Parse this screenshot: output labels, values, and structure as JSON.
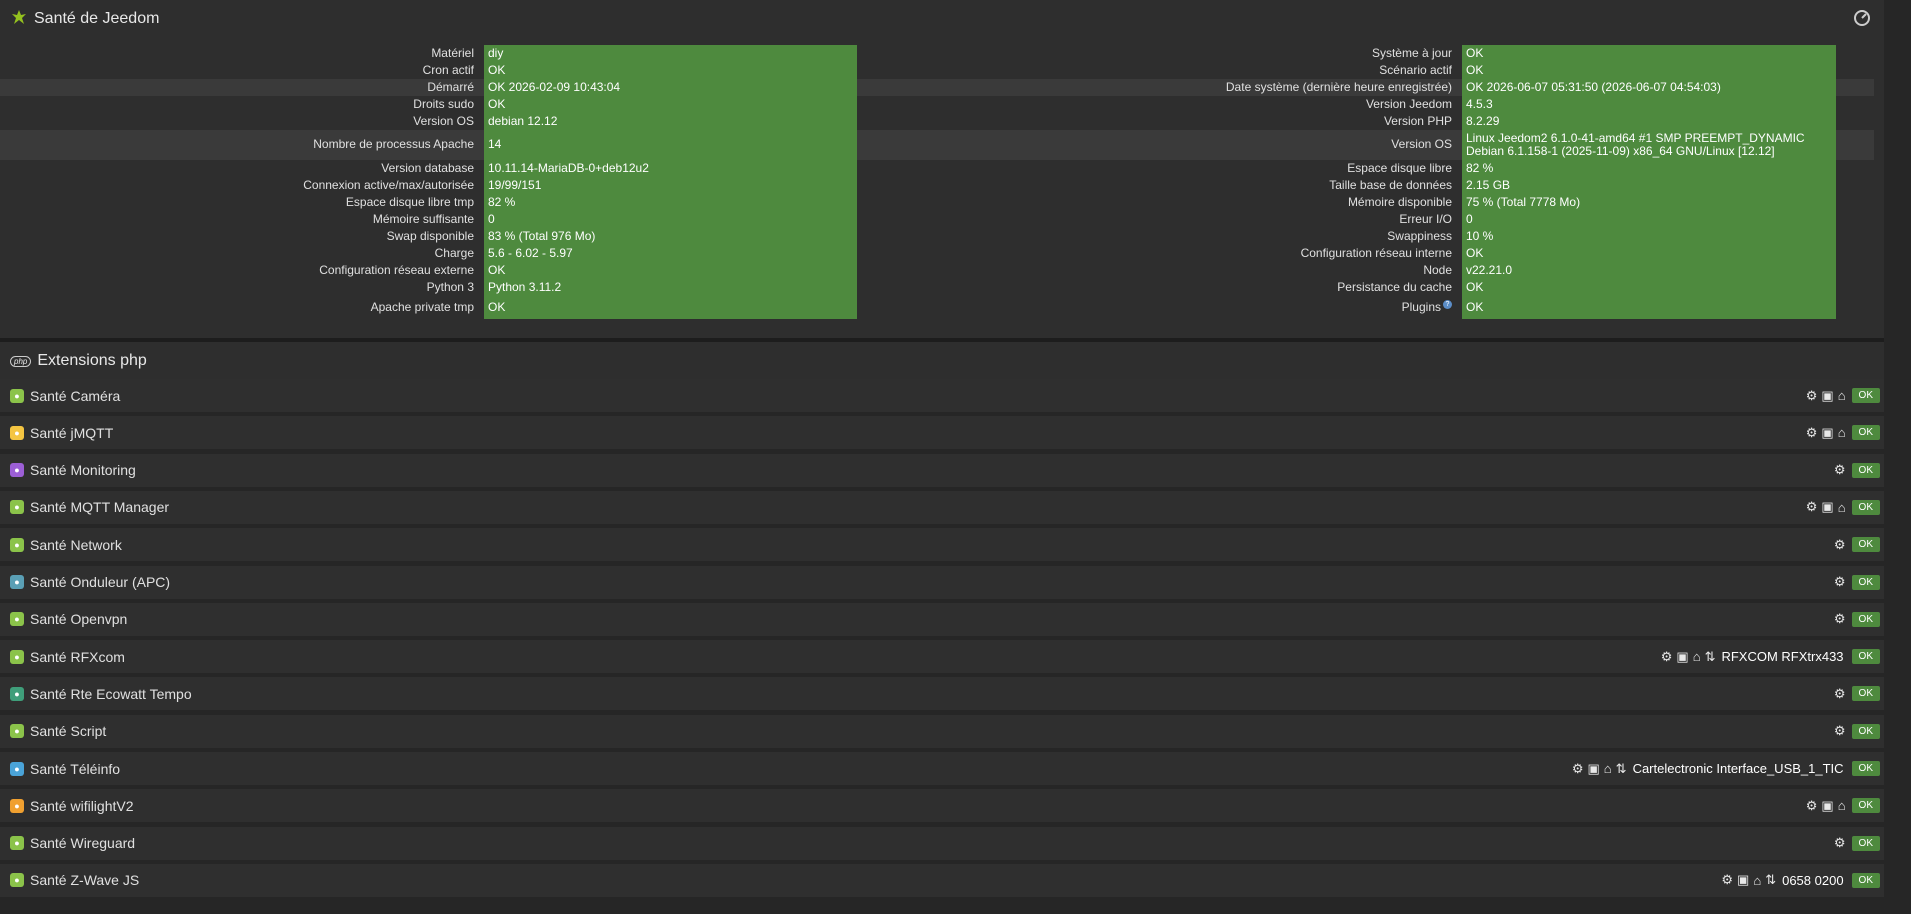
{
  "health": {
    "title": "Santé de Jeedom",
    "left": [
      {
        "label": "Matériel",
        "value": "diy"
      },
      {
        "label": "Cron actif",
        "value": "OK"
      },
      {
        "label": "Démarré",
        "value": "OK 2026-02-09 10:43:04"
      },
      {
        "label": "Droits sudo",
        "value": "OK"
      },
      {
        "label": "Version OS",
        "value": "debian 12.12"
      },
      {
        "label": "Nombre de processus Apache",
        "value": "14"
      },
      {
        "label": "Version database",
        "value": "10.11.14-MariaDB-0+deb12u2"
      },
      {
        "label": "Connexion active/max/autorisée",
        "value": "19/99/151"
      },
      {
        "label": "Espace disque libre tmp",
        "value": "82 %"
      },
      {
        "label": "Mémoire suffisante",
        "value": "0"
      },
      {
        "label": "Swap disponible",
        "value": "83 % (Total 976 Mo)"
      },
      {
        "label": "Charge",
        "value": "5.6 - 6.02 - 5.97"
      },
      {
        "label": "Configuration réseau externe",
        "value": "OK"
      },
      {
        "label": "Python 3",
        "value": "Python 3.11.2"
      },
      {
        "label": "Apache private tmp",
        "value": "OK"
      }
    ],
    "right": [
      {
        "label": "Système à jour",
        "value": "OK"
      },
      {
        "label": "Scénario actif",
        "value": "OK"
      },
      {
        "label": "Date système (dernière heure enregistrée)",
        "value": "OK 2026-06-07 05:31:50 (2026-06-07 04:54:03)"
      },
      {
        "label": "Version Jeedom",
        "value": "4.5.3"
      },
      {
        "label": "Version PHP",
        "value": "8.2.29"
      },
      {
        "label": "Version OS",
        "value": "Linux Jeedom2 6.1.0-41-amd64 #1 SMP PREEMPT_DYNAMIC Debian 6.1.158-1 (2025-11-09) x86_64 GNU/Linux [12.12]"
      },
      {
        "label": "Espace disque libre",
        "value": "82 %"
      },
      {
        "label": "Taille base de données",
        "value": "2.15 GB"
      },
      {
        "label": "Mémoire disponible",
        "value": "75 % (Total 7778 Mo)"
      },
      {
        "label": "Erreur I/O",
        "value": "0"
      },
      {
        "label": "Swappiness",
        "value": "10 %"
      },
      {
        "label": "Configuration réseau interne",
        "value": "OK"
      },
      {
        "label": "Node",
        "value": "v22.21.0"
      },
      {
        "label": "Persistance du cache",
        "value": "OK"
      },
      {
        "label": "Plugins",
        "value": "OK"
      }
    ]
  },
  "extensions": {
    "title": "Extensions php"
  },
  "plugins": [
    {
      "name": "Santé Caméra",
      "icon_color": "#8bc34a",
      "tools": [
        "gears-icon",
        "camera-icon",
        "bank-icon"
      ],
      "port": "",
      "status": "OK"
    },
    {
      "name": "Santé jMQTT",
      "icon_color": "#f4c542",
      "tools": [
        "gears-icon",
        "camera-icon",
        "bank-icon"
      ],
      "port": "",
      "status": "OK"
    },
    {
      "name": "Santé Monitoring",
      "icon_color": "#9c5fd6",
      "tools": [
        "gears-icon"
      ],
      "port": "",
      "status": "OK"
    },
    {
      "name": "Santé MQTT Manager",
      "icon_color": "#8bc34a",
      "tools": [
        "gears-icon",
        "camera-icon",
        "bank-icon"
      ],
      "port": "",
      "status": "OK"
    },
    {
      "name": "Santé Network",
      "icon_color": "#8bc34a",
      "tools": [
        "gears-icon"
      ],
      "port": "",
      "status": "OK"
    },
    {
      "name": "Santé Onduleur (APC)",
      "icon_color": "#5a9fb5",
      "tools": [
        "gears-icon"
      ],
      "port": "",
      "status": "OK"
    },
    {
      "name": "Santé Openvpn",
      "icon_color": "#8bc34a",
      "tools": [
        "gears-icon"
      ],
      "port": "",
      "status": "OK"
    },
    {
      "name": "Santé RFXcom",
      "icon_color": "#8bc34a",
      "tools": [
        "gears-icon",
        "camera-icon",
        "bank-icon",
        "arrows-icon"
      ],
      "port": "RFXCOM RFXtrx433",
      "status": "OK"
    },
    {
      "name": "Santé Rte Ecowatt Tempo",
      "icon_color": "#3f9e7a",
      "tools": [
        "gears-icon"
      ],
      "port": "",
      "status": "OK"
    },
    {
      "name": "Santé Script",
      "icon_color": "#8bc34a",
      "tools": [
        "gears-icon"
      ],
      "port": "",
      "status": "OK"
    },
    {
      "name": "Santé Téléinfo",
      "icon_color": "#4aa3d8",
      "tools": [
        "gears-icon",
        "camera-icon",
        "bank-icon",
        "arrows-icon"
      ],
      "port": "Cartelectronic Interface_USB_1_TIC",
      "status": "OK"
    },
    {
      "name": "Santé wifilightV2",
      "icon_color": "#f0a030",
      "tools": [
        "gears-icon",
        "camera-icon",
        "bank-icon"
      ],
      "port": "",
      "status": "OK"
    },
    {
      "name": "Santé Wireguard",
      "icon_color": "#8bc34a",
      "tools": [
        "gears-icon"
      ],
      "port": "",
      "status": "OK"
    },
    {
      "name": "Santé Z-Wave JS",
      "icon_color": "#8bc34a",
      "tools": [
        "gears-icon",
        "camera-icon",
        "bank-icon",
        "arrows-icon"
      ],
      "port": "0658 0200",
      "status": "OK"
    }
  ]
}
